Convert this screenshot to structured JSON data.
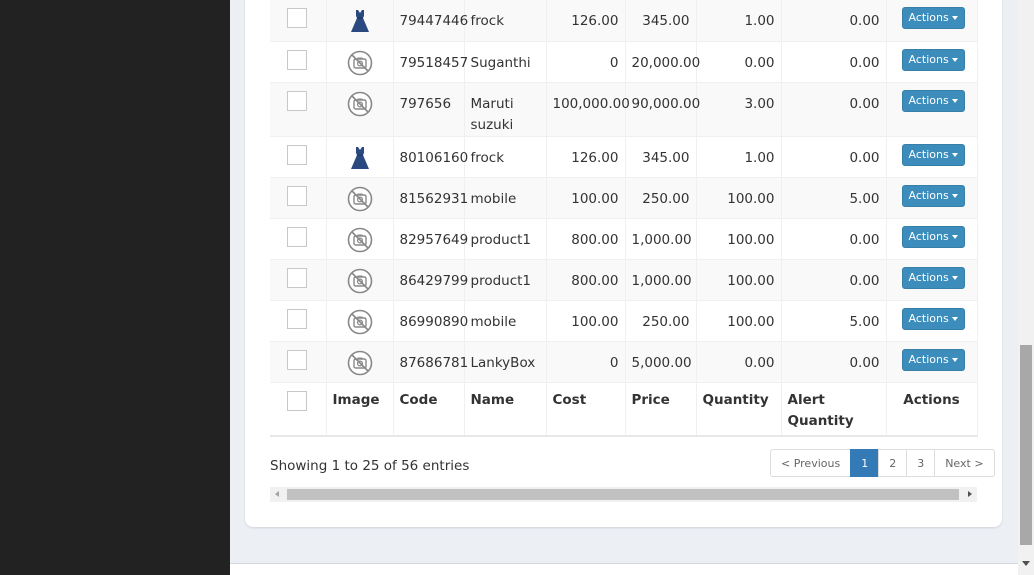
{
  "table": {
    "columns": [
      "Image",
      "Code",
      "Name",
      "Cost",
      "Price",
      "Quantity",
      "Alert Quantity",
      "Actions"
    ],
    "rows": [
      {
        "image": "dress-icon",
        "code": "79447446",
        "name": "frock",
        "cost": "126.00",
        "price": "345.00",
        "quantity": "1.00",
        "alert": "0.00",
        "action": "Actions"
      },
      {
        "image": "no-image-icon",
        "code": "79518457",
        "name": "Suganthi",
        "cost": "0",
        "price": "20,000.00",
        "quantity": "0.00",
        "alert": "0.00",
        "action": "Actions"
      },
      {
        "image": "no-image-icon",
        "code": "797656",
        "name": "Maruti suzuki",
        "cost": "100,000.00",
        "price": "90,000.00",
        "quantity": "3.00",
        "alert": "0.00",
        "action": "Actions"
      },
      {
        "image": "dress-icon",
        "code": "80106160",
        "name": "frock",
        "cost": "126.00",
        "price": "345.00",
        "quantity": "1.00",
        "alert": "0.00",
        "action": "Actions"
      },
      {
        "image": "no-image-icon",
        "code": "81562931",
        "name": "mobile",
        "cost": "100.00",
        "price": "250.00",
        "quantity": "100.00",
        "alert": "5.00",
        "action": "Actions"
      },
      {
        "image": "no-image-icon",
        "code": "82957649",
        "name": "product1",
        "cost": "800.00",
        "price": "1,000.00",
        "quantity": "100.00",
        "alert": "0.00",
        "action": "Actions"
      },
      {
        "image": "no-image-icon",
        "code": "86429799",
        "name": "product1",
        "cost": "800.00",
        "price": "1,000.00",
        "quantity": "100.00",
        "alert": "0.00",
        "action": "Actions"
      },
      {
        "image": "no-image-icon",
        "code": "86990890",
        "name": "mobile",
        "cost": "100.00",
        "price": "250.00",
        "quantity": "100.00",
        "alert": "5.00",
        "action": "Actions"
      },
      {
        "image": "no-image-icon",
        "code": "87686781",
        "name": "LankyBox",
        "cost": "0",
        "price": "5,000.00",
        "quantity": "0.00",
        "alert": "0.00",
        "action": "Actions"
      }
    ]
  },
  "info": "Showing 1 to 25 of 56 entries",
  "pagination": {
    "previous": "< Previous",
    "pages": [
      "1",
      "2",
      "3"
    ],
    "active_page": "1",
    "next": "Next >"
  },
  "colors": {
    "accent": "#3c8dbc",
    "active_page": "#337ab7",
    "sidebar": "#222222",
    "dress": "#2a4a7f"
  }
}
